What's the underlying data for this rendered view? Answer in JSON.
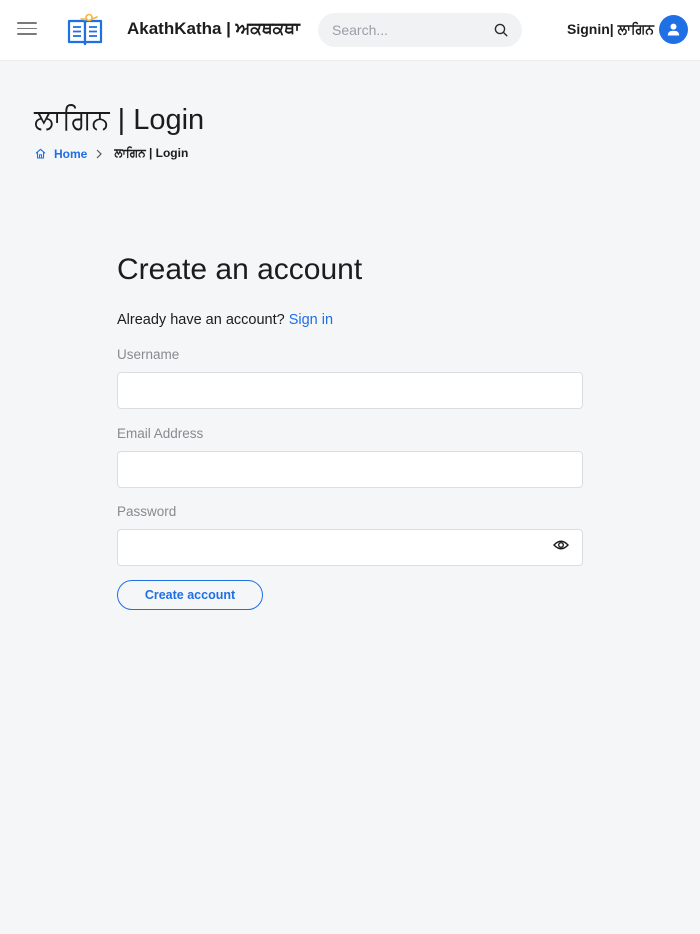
{
  "header": {
    "brand": "AkathKatha | ਅਕਥਕਥਾ",
    "search_placeholder": "Search...",
    "signin_label": "Signin| ਲਾਗਿਨ",
    "logo_icon": "open-book-icon",
    "menu_icon": "hamburger-icon",
    "search_icon": "search-icon",
    "avatar_icon": "user-icon"
  },
  "page": {
    "title": "ਲਾਗਿਨ | Login",
    "breadcrumb": {
      "home": "Home",
      "current": "ਲਾਗਿਨ | Login"
    }
  },
  "form": {
    "title": "Create an account",
    "already_text": "Already have an account?",
    "signin_link": "Sign in",
    "username_label": "Username",
    "username_value": "",
    "email_label": "Email Address",
    "email_value": "",
    "password_label": "Password",
    "password_value": "",
    "show_password_icon": "eye-icon",
    "submit_label": "Create account"
  },
  "colors": {
    "accent": "#1f6fe5",
    "background": "#f5f6f8",
    "header_bg": "#ffffff",
    "logo_gold": "#f2b53a"
  }
}
